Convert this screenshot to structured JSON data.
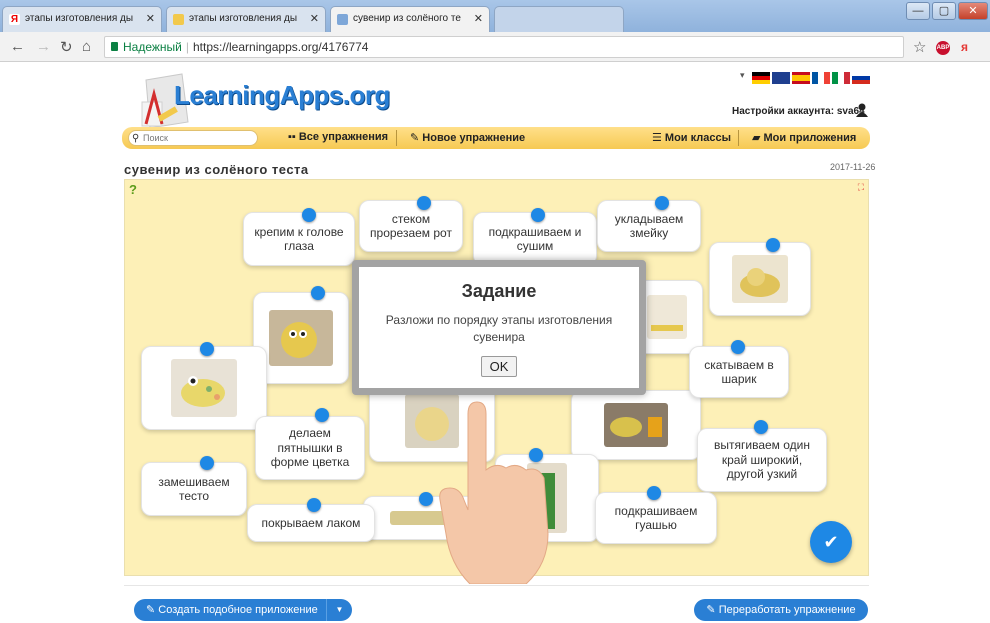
{
  "browser": {
    "tabs": [
      {
        "label": "этапы изготовления ды",
        "icon": "yandex-icon",
        "active": false
      },
      {
        "label": "этапы изготовления ды",
        "icon": "image-icon",
        "active": false
      },
      {
        "label": "сувенир из солёного те",
        "icon": "learningapps-icon",
        "active": true
      }
    ],
    "address": {
      "secure_label": "Надежный",
      "url": "https://learningapps.org/4176774"
    }
  },
  "site": {
    "logo_text": "LearningApps.org",
    "account_label": "Настройки аккаунта: sva64",
    "search_placeholder": "Поиск",
    "menu": {
      "all_exercises": "Все упражнения",
      "new_exercise": "Новое упражнение",
      "my_classes": "Мои классы",
      "my_apps": "Мои приложения"
    },
    "page_title": "сувенир из солёного теста",
    "page_date": "2017-11-26"
  },
  "cards": {
    "c1": "крепим к голове глаза",
    "c2": "стеком прорезаем рот",
    "c3": "подкрашиваем и сушим",
    "c4": "укладываем змейку",
    "c5": "скатываем в шарик",
    "c6": "делаем пятнышки в форме цветка",
    "c7": "вытягиваем один край широкий, другой узкий",
    "c8": "замешиваем тесто",
    "c9": "покрываем лаком",
    "c10": "подкрашиваем гуашью"
  },
  "modal": {
    "title": "Задание",
    "text": "Разложи по порядку этапы изготовления сувенира",
    "ok_label": "OK"
  },
  "buttons": {
    "create_similar": "Создать подобное приложение",
    "rework": "Переработать упражнение"
  },
  "colors": {
    "accent": "#1e88e5",
    "board": "#fdf0b7",
    "menubar": "#f6c953"
  }
}
